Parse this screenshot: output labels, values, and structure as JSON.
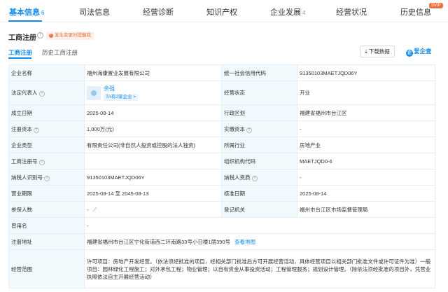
{
  "top_tabs": [
    {
      "label": "基本信息",
      "count": "6"
    },
    {
      "label": "司法信息",
      "count": ""
    },
    {
      "label": "经营诊断",
      "count": ""
    },
    {
      "label": "知识产权",
      "count": ""
    },
    {
      "label": "企业发展",
      "count": "4"
    },
    {
      "label": "经营状况",
      "count": ""
    },
    {
      "label": "历史信息",
      "count": ""
    }
  ],
  "svip_label": "SVIP",
  "section": {
    "title": "工商注册",
    "help_glyph": "?",
    "notice": "发生变更时提醒我",
    "notice_glyph": "!"
  },
  "sub_tabs": [
    {
      "label": "工商注册"
    },
    {
      "label": "历史工商注册"
    }
  ],
  "toolbar": {
    "download_label": "下载数据",
    "download_glyph": "⤓",
    "logo_text": "爱企查",
    "logo_mark": "企"
  },
  "table": {
    "company_name_label": "企业名称",
    "company_name": "福州海康置业发展有限公司",
    "credit_code_label": "统一社会信用代码",
    "credit_code": "91350103MAETJQD06Y",
    "legal_rep_label": "法定代表人",
    "legal_rep_name": "余强",
    "legal_rep_tag": "TA有2家企业 >",
    "status_label": "经营状态",
    "status": "开业",
    "established_label": "成立日期",
    "established": "2025-08-14",
    "region_label": "行政区划",
    "region": "福建省福州市台江区",
    "reg_capital_label": "注册资本",
    "reg_capital": "1,000万(元)",
    "paid_capital_label": "实缴资本",
    "paid_capital": "-",
    "company_type_label": "企业类型",
    "company_type": "有限责任公司(非自然人投资或控股的法人独资)",
    "industry_label": "所属行业",
    "industry": "房地产业",
    "reg_no_label": "工商注册号",
    "reg_no": "",
    "org_code_label": "组织机构代码",
    "org_code": "MAETJQD0-6",
    "taxpayer_id_label": "纳税人识别号",
    "taxpayer_id": "91350103MAETJQD06Y",
    "taxpayer_qual_label": "纳税人资质",
    "taxpayer_qual": "-",
    "term_label": "营业期限",
    "term": "2025-08-14 至 2045-08-13",
    "approval_date_label": "核准日期",
    "approval_date": "2025-08-14",
    "insured_label": "参保人数",
    "insured": "-",
    "authority_label": "登记机关",
    "authority": "福州市台江区市场监督管理局",
    "former_name_label": "曾用名",
    "former_name": "-",
    "address_label": "注册地址",
    "address": "福建省福州市台江区宁化街道西二环南路33号小日楼1层390号",
    "map_link": "查看地图",
    "scope_label": "经营范围",
    "scope": "许可项目：房地产开发经营。（依法须经批准的项目，经相关部门批准后方可开展经营活动，具体经营项目以相关部门批准文件或许可证件为准）一般项目：园林绿化工程施工；对外承包工程；物业管理；以自有资金从事投资活动；工程管理服务；规划设计管理。（除依法须经批准的项目外，凭营业执照依法自主开展经营活动）",
    "qmark": "?",
    "trend_glyph": "⟋"
  }
}
